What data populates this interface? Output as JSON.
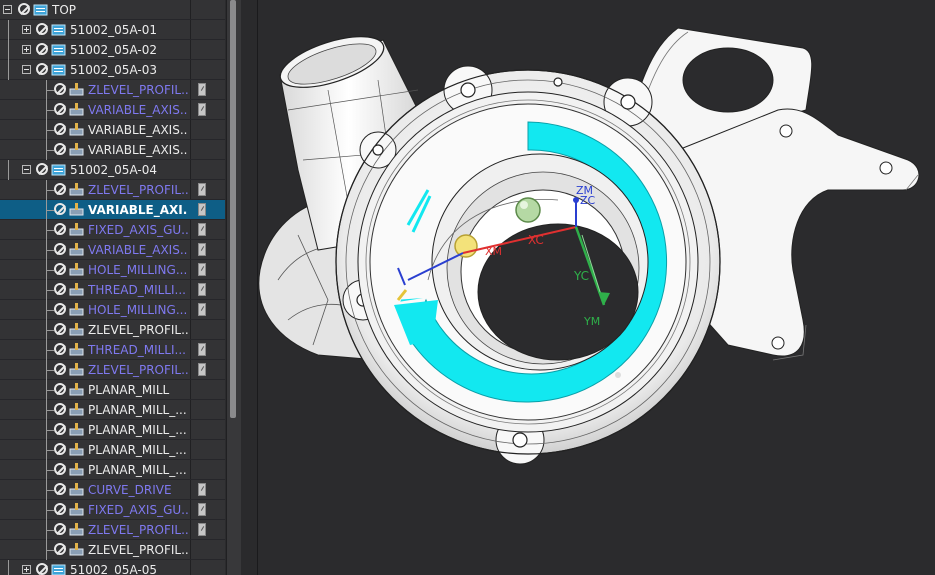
{
  "navigator": {
    "rows": [
      {
        "label": "TOP",
        "type": "root",
        "style": "white"
      },
      {
        "label": "51002_05A-01",
        "type": "group",
        "style": "white",
        "expander": "plus"
      },
      {
        "label": "51002_05A-02",
        "type": "group",
        "style": "white",
        "expander": "plus"
      },
      {
        "label": "51002_05A-03",
        "type": "group",
        "style": "white",
        "expander": "minus"
      },
      {
        "label": "ZLEVEL_PROFIL...",
        "type": "op",
        "style": "blue",
        "flag": true
      },
      {
        "label": "VARIABLE_AXIS...",
        "type": "op",
        "style": "blue",
        "flag": true
      },
      {
        "label": "VARIABLE_AXIS...",
        "type": "op",
        "style": "white",
        "flag": false
      },
      {
        "label": "VARIABLE_AXIS...",
        "type": "op",
        "style": "white",
        "flag": false
      },
      {
        "label": "51002_05A-04",
        "type": "group",
        "style": "white",
        "expander": "minus"
      },
      {
        "label": "ZLEVEL_PROFIL...",
        "type": "op",
        "style": "blue",
        "flag": true
      },
      {
        "label": "VARIABLE_AXI...",
        "type": "op",
        "style": "white",
        "flag": true,
        "selected": true
      },
      {
        "label": "FIXED_AXIS_GU...",
        "type": "op",
        "style": "blue",
        "flag": true
      },
      {
        "label": "VARIABLE_AXIS...",
        "type": "op",
        "style": "blue",
        "flag": true
      },
      {
        "label": "HOLE_MILLING...",
        "type": "op",
        "style": "blue",
        "flag": true
      },
      {
        "label": "THREAD_MILLI...",
        "type": "op",
        "style": "blue",
        "flag": true
      },
      {
        "label": "HOLE_MILLING...",
        "type": "op",
        "style": "blue",
        "flag": true
      },
      {
        "label": "ZLEVEL_PROFIL...",
        "type": "op",
        "style": "white",
        "flag": false
      },
      {
        "label": "THREAD_MILLI...",
        "type": "op",
        "style": "blue",
        "flag": true
      },
      {
        "label": "ZLEVEL_PROFIL...",
        "type": "op",
        "style": "blue",
        "flag": true
      },
      {
        "label": "PLANAR_MILL",
        "type": "op",
        "style": "white",
        "flag": false
      },
      {
        "label": "PLANAR_MILL_...",
        "type": "op",
        "style": "white",
        "flag": false
      },
      {
        "label": "PLANAR_MILL_...",
        "type": "op",
        "style": "white",
        "flag": false
      },
      {
        "label": "PLANAR_MILL_...",
        "type": "op",
        "style": "white",
        "flag": false
      },
      {
        "label": "PLANAR_MILL_...",
        "type": "op",
        "style": "white",
        "flag": false
      },
      {
        "label": "CURVE_DRIVE",
        "type": "op",
        "style": "blue",
        "flag": true
      },
      {
        "label": "FIXED_AXIS_GU...",
        "type": "op",
        "style": "blue",
        "flag": true
      },
      {
        "label": "ZLEVEL_PROFIL...",
        "type": "op",
        "style": "blue",
        "flag": true
      },
      {
        "label": "ZLEVEL_PROFIL...",
        "type": "op",
        "style": "white",
        "flag": false
      },
      {
        "label": "51002_05A-05",
        "type": "group",
        "style": "white",
        "expander": "plus"
      }
    ]
  },
  "viewport": {
    "axes": {
      "xc": "XC",
      "yc": "YC",
      "zc": "ZC",
      "xm": "XM",
      "ym": "YM",
      "zm": "ZM"
    },
    "colors": {
      "background": "#2b2b2d",
      "part": "#ffffff",
      "toolpath_band": "#12e8f0",
      "xc_axis": "#e03030",
      "yc_axis": "#2fb04a",
      "zc_axis": "#2a3fd0"
    }
  }
}
